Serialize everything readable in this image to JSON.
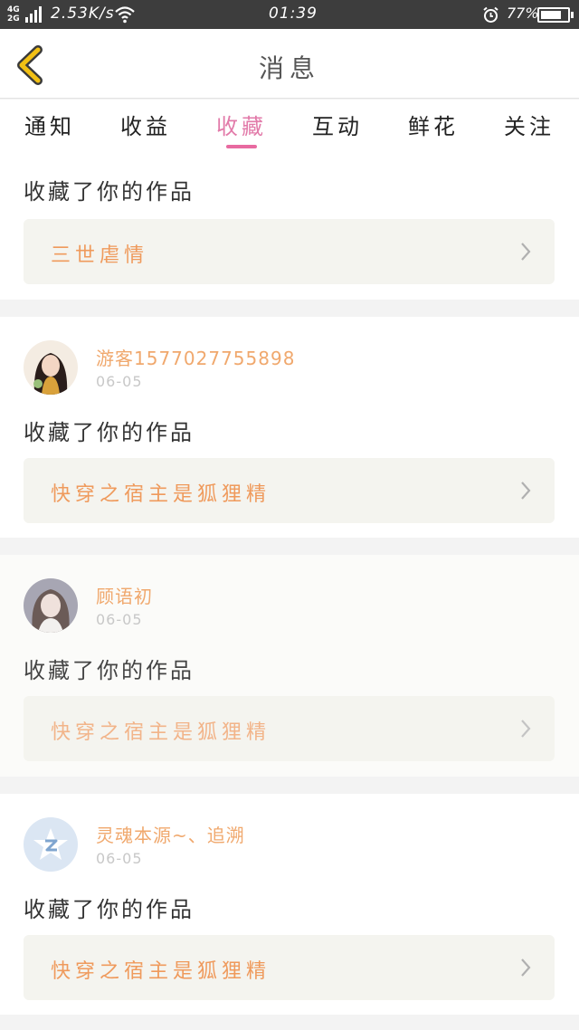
{
  "status_bar": {
    "network_top": "4G",
    "network_bottom": "2G",
    "speed": "2.53K/s",
    "time": "01:39",
    "battery_percent": "77%",
    "battery_level": 0.77,
    "icons": [
      "signal-icon",
      "wifi-icon",
      "alarm-icon",
      "battery-icon"
    ]
  },
  "header": {
    "title": "消息",
    "back_icon": "chevron-left-icon",
    "back_color": "#f2c014"
  },
  "tabs": [
    {
      "label": "通知"
    },
    {
      "label": "收益"
    },
    {
      "label": "收藏",
      "active": true
    },
    {
      "label": "互动"
    },
    {
      "label": "鲜花"
    },
    {
      "label": "关注"
    }
  ],
  "colors": {
    "accent": "#e27aa9",
    "username": "#f0a86d",
    "work_title": "#ef9a5c"
  },
  "messages": [
    {
      "action": "收藏了你的作品",
      "work_title": "三世虐情"
    },
    {
      "username": "游客1577027755898",
      "date": "06-05",
      "action": "收藏了你的作品",
      "work_title": "快穿之宿主是狐狸精"
    },
    {
      "username": "顾语初",
      "date": "06-05",
      "action": "收藏了你的作品",
      "work_title": "快穿之宿主是狐狸精"
    },
    {
      "username": "灵魂本源~、追溯",
      "date": "06-05",
      "action": "收藏了你的作品",
      "work_title": "快穿之宿主是狐狸精"
    }
  ]
}
